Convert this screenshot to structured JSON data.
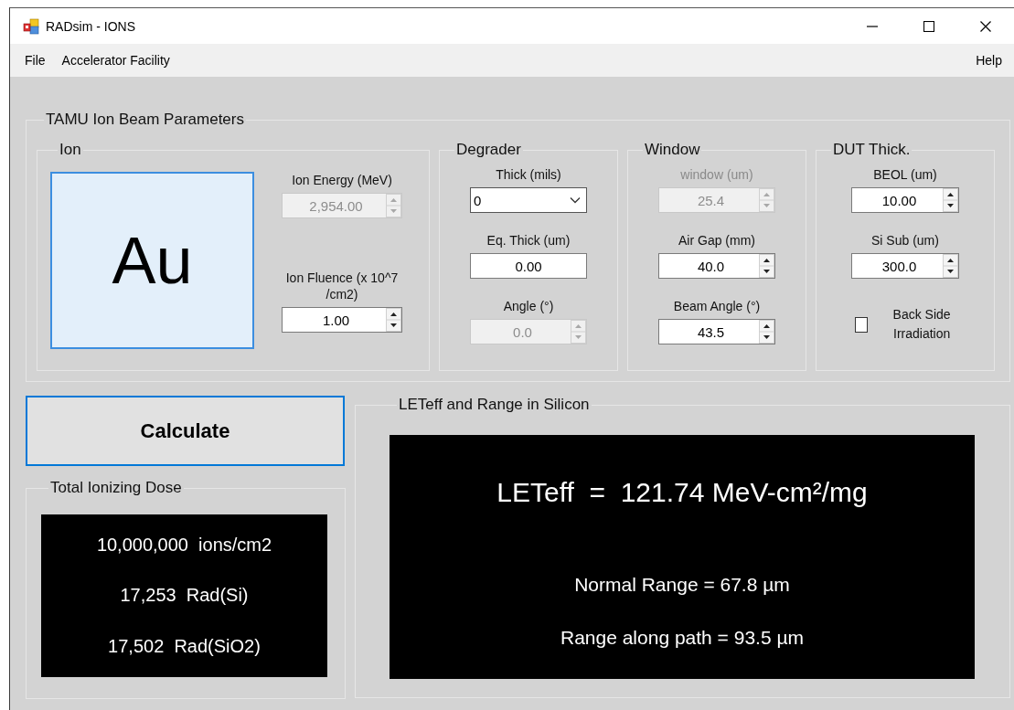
{
  "window": {
    "title": "RADsim - IONS"
  },
  "menu": {
    "items": [
      {
        "label": "File"
      },
      {
        "label": "Accelerator Facility"
      }
    ],
    "right_items": [
      {
        "label": "Help"
      }
    ]
  },
  "parameters": {
    "title": "TAMU Ion Beam Parameters",
    "ion": {
      "title": "Ion",
      "symbol": "Au",
      "fields": [
        {
          "kind": "spinner",
          "label": "Ion Energy (MeV)",
          "value": "2,954.00",
          "disabled": true,
          "label_disabled": false
        },
        {
          "kind": "spinner",
          "label": "Ion Fluence (x 10^7 /cm2)",
          "value": "1.00",
          "disabled": false,
          "label_disabled": false
        }
      ]
    },
    "groups": [
      {
        "title": "Degrader",
        "fields": [
          {
            "kind": "dropdown",
            "label": "Thick (mils)",
            "value": "0",
            "disabled": false,
            "label_disabled": false
          },
          {
            "kind": "text",
            "label": "Eq. Thick (um)",
            "value": "0.00",
            "disabled": false,
            "label_disabled": false
          },
          {
            "kind": "spinner",
            "label": "Angle (°)",
            "value": "0.0",
            "disabled": true,
            "label_disabled": false
          }
        ]
      },
      {
        "title": "Window",
        "fields": [
          {
            "kind": "spinner",
            "label": "window (um)",
            "value": "25.4",
            "disabled": true,
            "label_disabled": true
          },
          {
            "kind": "spinner",
            "label": "Air Gap (mm)",
            "value": "40.0",
            "disabled": false,
            "label_disabled": false
          },
          {
            "kind": "spinner",
            "label": "Beam Angle (°)",
            "value": "43.5",
            "disabled": false,
            "label_disabled": false
          }
        ]
      },
      {
        "title": "DUT Thick.",
        "fields": [
          {
            "kind": "spinner",
            "label": "BEOL (um)",
            "value": "10.00",
            "disabled": false,
            "label_disabled": false
          },
          {
            "kind": "spinner",
            "label": "Si Sub (um)",
            "value": "300.0",
            "disabled": false,
            "label_disabled": false
          },
          {
            "kind": "checkbox",
            "label": "Back Side Irradiation",
            "checked": false
          }
        ]
      }
    ]
  },
  "calculate_button": {
    "label": "Calculate"
  },
  "total_ionizing_dose": {
    "title": "Total Ionizing Dose",
    "lines": [
      "10,000,000  ions/cm2",
      "17,253  Rad(Si)",
      "17,502  Rad(SiO2)"
    ]
  },
  "let_range": {
    "title": "LETeff and Range in Silicon",
    "headline": "LETeff  =  121.74 MeV-cm²/mg",
    "lines": [
      "Normal Range = 67.8 µm",
      "Range along path = 93.5 µm"
    ]
  }
}
